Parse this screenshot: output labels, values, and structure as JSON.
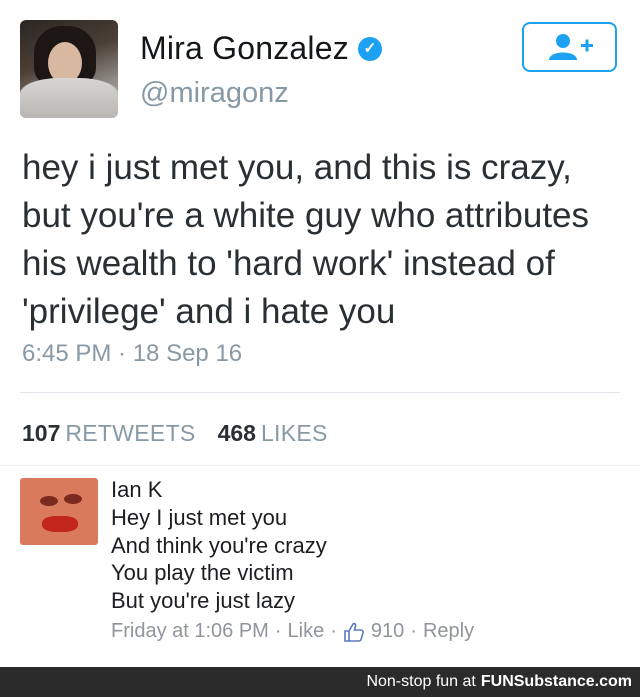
{
  "tweet": {
    "author": {
      "name": "Mira Gonzalez",
      "handle": "@miragonz",
      "verified": true
    },
    "text_lines": [
      "hey i just met you, and this is crazy,",
      "but you're a white guy who attributes",
      "his wealth to 'hard work' instead of",
      "'privilege' and i hate you"
    ],
    "timestamp": "6:45 PM · 18 Sep 16",
    "stats": {
      "retweets_count": "107",
      "retweets_label": "RETWEETS",
      "likes_count": "468",
      "likes_label": "LIKES"
    }
  },
  "reply": {
    "author": "Ian K",
    "lines": [
      "Hey I just met you",
      "And think you're crazy",
      "You play the victim",
      "But you're just lazy"
    ],
    "time": "Friday at 1:06 PM",
    "like_label": "Like",
    "like_count": "910",
    "reply_label": "Reply"
  },
  "footer": {
    "text": "Non-stop fun at",
    "brand": "FUNSubstance.com"
  },
  "colors": {
    "accent": "#1da1f2",
    "muted": "#8899a6",
    "footer_bg": "#2b2b2b"
  }
}
